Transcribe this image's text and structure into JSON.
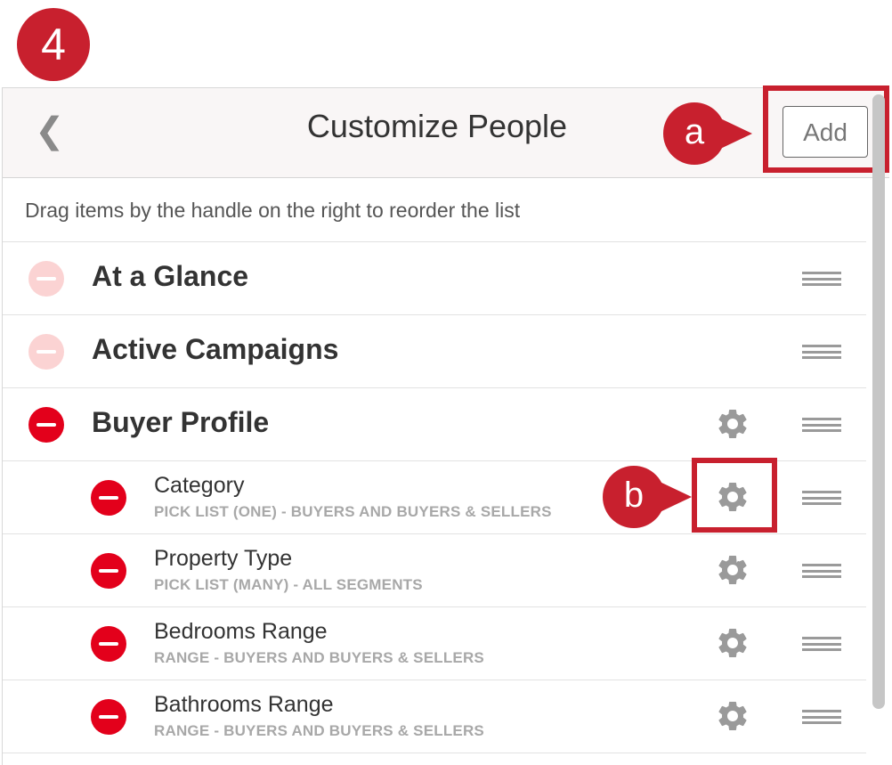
{
  "step_badge": "4",
  "header": {
    "back_glyph": "❮",
    "title": "Customize People",
    "add_label": "Add"
  },
  "callouts": {
    "a": "a",
    "b": "b"
  },
  "hint": "Drag items by the handle on the right to reorder the list",
  "rows": [
    {
      "label": "At a Glance",
      "level": "main",
      "removable": false,
      "has_settings": false
    },
    {
      "label": "Active Campaigns",
      "level": "main",
      "removable": false,
      "has_settings": false
    },
    {
      "label": "Buyer Profile",
      "level": "main",
      "removable": true,
      "has_settings": true
    },
    {
      "label": "Category",
      "desc": "PICK LIST (ONE) - BUYERS AND BUYERS & SELLERS",
      "level": "sub",
      "has_settings": true
    },
    {
      "label": "Property Type",
      "desc": "PICK LIST (MANY) - ALL SEGMENTS",
      "level": "sub",
      "has_settings": true
    },
    {
      "label": "Bedrooms Range",
      "desc": "RANGE - BUYERS AND BUYERS & SELLERS",
      "level": "sub",
      "has_settings": true
    },
    {
      "label": "Bathrooms Range",
      "desc": "RANGE - BUYERS AND BUYERS & SELLERS",
      "level": "sub",
      "has_settings": true
    }
  ],
  "icons": {
    "remove": "minus-circle-icon",
    "settings": "gear-icon",
    "drag": "drag-handle-icon",
    "back": "chevron-left-icon"
  },
  "colors": {
    "accent_red": "#c8202e",
    "remove_red": "#e3001b",
    "remove_disabled": "#fbd3d3"
  }
}
